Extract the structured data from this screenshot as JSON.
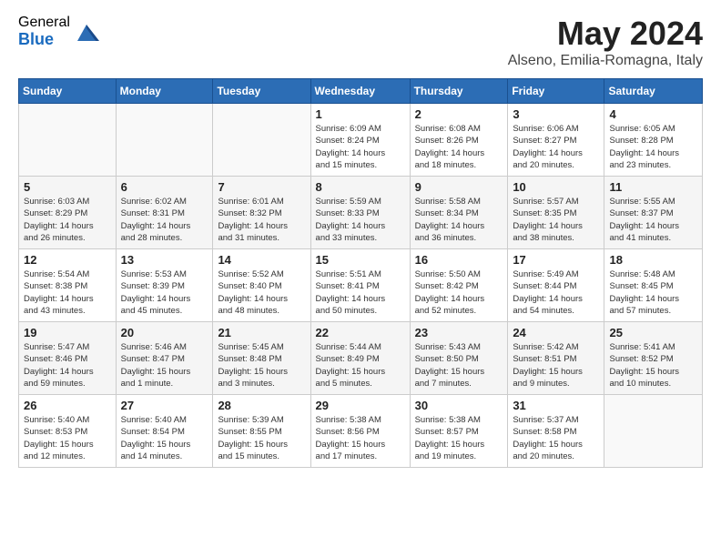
{
  "logo": {
    "general": "General",
    "blue": "Blue"
  },
  "title": "May 2024",
  "location": "Alseno, Emilia-Romagna, Italy",
  "days_header": [
    "Sunday",
    "Monday",
    "Tuesday",
    "Wednesday",
    "Thursday",
    "Friday",
    "Saturday"
  ],
  "weeks": [
    [
      {
        "day": "",
        "info": ""
      },
      {
        "day": "",
        "info": ""
      },
      {
        "day": "",
        "info": ""
      },
      {
        "day": "1",
        "info": "Sunrise: 6:09 AM\nSunset: 8:24 PM\nDaylight: 14 hours\nand 15 minutes."
      },
      {
        "day": "2",
        "info": "Sunrise: 6:08 AM\nSunset: 8:26 PM\nDaylight: 14 hours\nand 18 minutes."
      },
      {
        "day": "3",
        "info": "Sunrise: 6:06 AM\nSunset: 8:27 PM\nDaylight: 14 hours\nand 20 minutes."
      },
      {
        "day": "4",
        "info": "Sunrise: 6:05 AM\nSunset: 8:28 PM\nDaylight: 14 hours\nand 23 minutes."
      }
    ],
    [
      {
        "day": "5",
        "info": "Sunrise: 6:03 AM\nSunset: 8:29 PM\nDaylight: 14 hours\nand 26 minutes."
      },
      {
        "day": "6",
        "info": "Sunrise: 6:02 AM\nSunset: 8:31 PM\nDaylight: 14 hours\nand 28 minutes."
      },
      {
        "day": "7",
        "info": "Sunrise: 6:01 AM\nSunset: 8:32 PM\nDaylight: 14 hours\nand 31 minutes."
      },
      {
        "day": "8",
        "info": "Sunrise: 5:59 AM\nSunset: 8:33 PM\nDaylight: 14 hours\nand 33 minutes."
      },
      {
        "day": "9",
        "info": "Sunrise: 5:58 AM\nSunset: 8:34 PM\nDaylight: 14 hours\nand 36 minutes."
      },
      {
        "day": "10",
        "info": "Sunrise: 5:57 AM\nSunset: 8:35 PM\nDaylight: 14 hours\nand 38 minutes."
      },
      {
        "day": "11",
        "info": "Sunrise: 5:55 AM\nSunset: 8:37 PM\nDaylight: 14 hours\nand 41 minutes."
      }
    ],
    [
      {
        "day": "12",
        "info": "Sunrise: 5:54 AM\nSunset: 8:38 PM\nDaylight: 14 hours\nand 43 minutes."
      },
      {
        "day": "13",
        "info": "Sunrise: 5:53 AM\nSunset: 8:39 PM\nDaylight: 14 hours\nand 45 minutes."
      },
      {
        "day": "14",
        "info": "Sunrise: 5:52 AM\nSunset: 8:40 PM\nDaylight: 14 hours\nand 48 minutes."
      },
      {
        "day": "15",
        "info": "Sunrise: 5:51 AM\nSunset: 8:41 PM\nDaylight: 14 hours\nand 50 minutes."
      },
      {
        "day": "16",
        "info": "Sunrise: 5:50 AM\nSunset: 8:42 PM\nDaylight: 14 hours\nand 52 minutes."
      },
      {
        "day": "17",
        "info": "Sunrise: 5:49 AM\nSunset: 8:44 PM\nDaylight: 14 hours\nand 54 minutes."
      },
      {
        "day": "18",
        "info": "Sunrise: 5:48 AM\nSunset: 8:45 PM\nDaylight: 14 hours\nand 57 minutes."
      }
    ],
    [
      {
        "day": "19",
        "info": "Sunrise: 5:47 AM\nSunset: 8:46 PM\nDaylight: 14 hours\nand 59 minutes."
      },
      {
        "day": "20",
        "info": "Sunrise: 5:46 AM\nSunset: 8:47 PM\nDaylight: 15 hours\nand 1 minute."
      },
      {
        "day": "21",
        "info": "Sunrise: 5:45 AM\nSunset: 8:48 PM\nDaylight: 15 hours\nand 3 minutes."
      },
      {
        "day": "22",
        "info": "Sunrise: 5:44 AM\nSunset: 8:49 PM\nDaylight: 15 hours\nand 5 minutes."
      },
      {
        "day": "23",
        "info": "Sunrise: 5:43 AM\nSunset: 8:50 PM\nDaylight: 15 hours\nand 7 minutes."
      },
      {
        "day": "24",
        "info": "Sunrise: 5:42 AM\nSunset: 8:51 PM\nDaylight: 15 hours\nand 9 minutes."
      },
      {
        "day": "25",
        "info": "Sunrise: 5:41 AM\nSunset: 8:52 PM\nDaylight: 15 hours\nand 10 minutes."
      }
    ],
    [
      {
        "day": "26",
        "info": "Sunrise: 5:40 AM\nSunset: 8:53 PM\nDaylight: 15 hours\nand 12 minutes."
      },
      {
        "day": "27",
        "info": "Sunrise: 5:40 AM\nSunset: 8:54 PM\nDaylight: 15 hours\nand 14 minutes."
      },
      {
        "day": "28",
        "info": "Sunrise: 5:39 AM\nSunset: 8:55 PM\nDaylight: 15 hours\nand 15 minutes."
      },
      {
        "day": "29",
        "info": "Sunrise: 5:38 AM\nSunset: 8:56 PM\nDaylight: 15 hours\nand 17 minutes."
      },
      {
        "day": "30",
        "info": "Sunrise: 5:38 AM\nSunset: 8:57 PM\nDaylight: 15 hours\nand 19 minutes."
      },
      {
        "day": "31",
        "info": "Sunrise: 5:37 AM\nSunset: 8:58 PM\nDaylight: 15 hours\nand 20 minutes."
      },
      {
        "day": "",
        "info": ""
      }
    ]
  ]
}
